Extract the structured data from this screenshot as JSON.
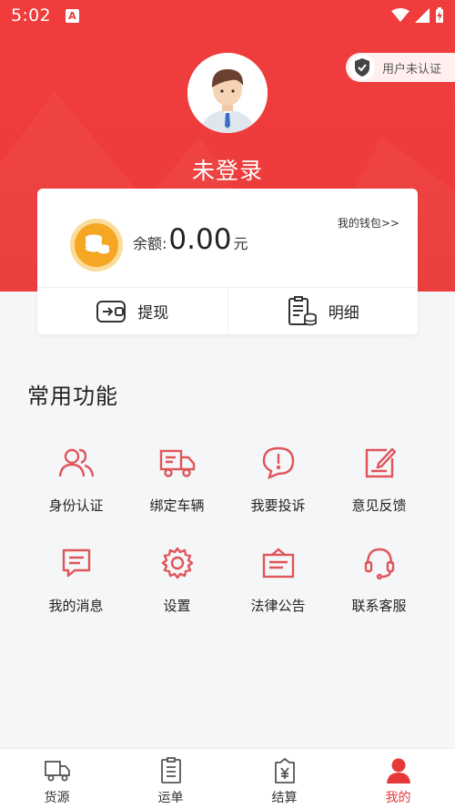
{
  "status_bar": {
    "time": "5:02",
    "notification_glyph": "A"
  },
  "profile": {
    "verify_badge": "用户未认证",
    "name": "未登录"
  },
  "wallet": {
    "balance_label": "余额:",
    "balance_value": "0.00",
    "balance_unit": "元",
    "link": "我的钱包>>",
    "actions": [
      {
        "label": "提现",
        "icon": "withdraw-icon"
      },
      {
        "label": "明细",
        "icon": "details-icon"
      }
    ]
  },
  "functions": {
    "title": "常用功能",
    "items": [
      {
        "label": "身份认证",
        "icon": "users-icon"
      },
      {
        "label": "绑定车辆",
        "icon": "truck-icon"
      },
      {
        "label": "我要投诉",
        "icon": "complaint-icon"
      },
      {
        "label": "意见反馈",
        "icon": "feedback-edit-icon"
      },
      {
        "label": "我的消息",
        "icon": "message-icon"
      },
      {
        "label": "设置",
        "icon": "gear-icon"
      },
      {
        "label": "法律公告",
        "icon": "notice-board-icon"
      },
      {
        "label": "联系客服",
        "icon": "headset-icon"
      }
    ]
  },
  "tabs": [
    {
      "label": "货源",
      "icon": "cargo-truck-icon",
      "active": false
    },
    {
      "label": "运单",
      "icon": "waybill-icon",
      "active": false
    },
    {
      "label": "结算",
      "icon": "settlement-icon",
      "active": false
    },
    {
      "label": "我的",
      "icon": "profile-icon",
      "active": true
    }
  ],
  "colors": {
    "brand_red": "#ee3b3b",
    "icon_red": "#e0555a",
    "coin_orange": "#f5a623",
    "active_tab": "#e63838"
  }
}
